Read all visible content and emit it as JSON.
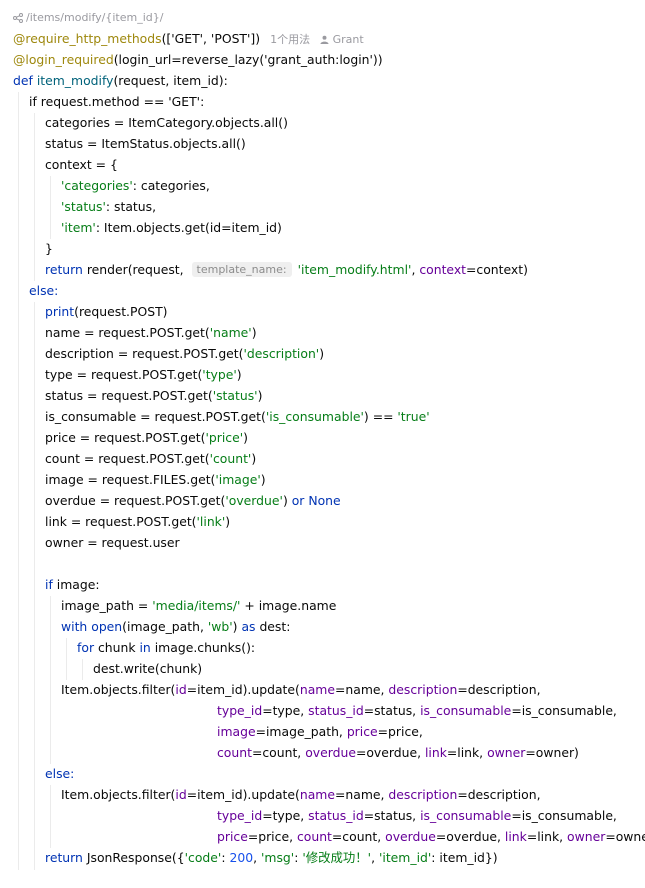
{
  "header": {
    "route": "/items/modify/{item_id}/",
    "usage_count": "1个用法",
    "author": "Grant"
  },
  "code": {
    "l1_dec": "@require_http_methods",
    "l1_args": "(['GET', 'POST'])",
    "l2_dec": "@login_required",
    "l2_args": "(login_url=reverse_lazy('grant_auth:login'))",
    "l3_kw": "def",
    "l3_name": "item_modify",
    "l3_rest": "(request, item_id):",
    "l4": "if request.method == 'GET':",
    "l5": "categories = ItemCategory.objects.all()",
    "l6": "status = ItemStatus.objects.all()",
    "l7": "context = {",
    "l8_str": "'categories'",
    "l8_rest": ": categories,",
    "l9_str": "'status'",
    "l9_rest": ": status,",
    "l10_str": "'item'",
    "l10_rest": ": Item.objects.get(id=item_id)",
    "l11": "}",
    "l12_kw": "return",
    "l12_a": " render(request, ",
    "l12_hint": "template_name:",
    "l12_str": "'item_modify.html'",
    "l12_b": ", ",
    "l12_prm": "context",
    "l12_c": "=context)",
    "l13": "else:",
    "l14_fn": "print",
    "l14_rest": "(request.POST)",
    "l15_a": "name = request.POST.get(",
    "l15_str": "'name'",
    "l16_a": "description = request.POST.get(",
    "l16_str": "'description'",
    "l17_a": "type = request.POST.get(",
    "l17_str": "'type'",
    "l18_a": "status = request.POST.get(",
    "l18_str": "'status'",
    "l19_a": "is_consumable = request.POST.get(",
    "l19_str": "'is_consumable'",
    "l19_b": ") == ",
    "l19_str2": "'true'",
    "l20_a": "price = request.POST.get(",
    "l20_str": "'price'",
    "l21_a": "count = request.POST.get(",
    "l21_str": "'count'",
    "l22_a": "image = request.FILES.get(",
    "l22_str": "'image'",
    "l23_a": "overdue = request.POST.get(",
    "l23_str": "'overdue'",
    "l23_b": ") ",
    "l23_kw": "or None",
    "l24_a": "link = request.POST.get(",
    "l24_str": "'link'",
    "l25": "owner = request.user",
    "l27_kw": "if",
    "l27_rest": " image:",
    "l28_a": "image_path = ",
    "l28_str": "'media/items/'",
    "l28_b": " + image.name",
    "l29_kw": "with",
    "l29_fn": " open",
    "l29_a": "(image_path, ",
    "l29_str": "'wb'",
    "l29_b": ") ",
    "l29_kw2": "as",
    "l29_c": " dest:",
    "l30_kw": "for",
    "l30_a": " chunk ",
    "l30_kw2": "in",
    "l30_b": " image.chunks():",
    "l31": "dest.write(chunk)",
    "l32_a": "Item.objects.filter(",
    "l32_p1": "id",
    "l32_b": "=item_id).update(",
    "l32_p2": "name",
    "l32_c": "=name, ",
    "l32_p3": "description",
    "l32_d": "=description,",
    "l33_p1": "type_id",
    "l33_a": "=type, ",
    "l33_p2": "status_id",
    "l33_b": "=status, ",
    "l33_p3": "is_consumable",
    "l33_c": "=is_consumable,",
    "l34_p1": "image",
    "l34_a": "=image_path, ",
    "l34_p2": "price",
    "l34_b": "=price,",
    "l35_p1": "count",
    "l35_a": "=count, ",
    "l35_p2": "overdue",
    "l35_b": "=overdue, ",
    "l35_p3": "link",
    "l35_c": "=link, ",
    "l35_p4": "owner",
    "l35_d": "=owner)",
    "l36": "else:",
    "l37_a": "Item.objects.filter(",
    "l37_p1": "id",
    "l37_b": "=item_id).update(",
    "l37_p2": "name",
    "l37_c": "=name, ",
    "l37_p3": "description",
    "l37_d": "=description,",
    "l38_p1": "type_id",
    "l38_a": "=type, ",
    "l38_p2": "status_id",
    "l38_b": "=status, ",
    "l38_p3": "is_consumable",
    "l38_c": "=is_consumable,",
    "l39_p1": "price",
    "l39_a": "=price, ",
    "l39_p2": "count",
    "l39_b": "=count, ",
    "l39_p3": "overdue",
    "l39_c": "=overdue, ",
    "l39_p4": "link",
    "l39_d": "=link, ",
    "l39_p5": "owner",
    "l39_e": "=owner)",
    "l40_kw": "return",
    "l40_a": " JsonResponse({",
    "l40_s1": "'code'",
    "l40_b": ": ",
    "l40_n": "200",
    "l40_c": ", ",
    "l40_s2": "'msg'",
    "l40_d": ": ",
    "l40_s3": "'修改成功！'",
    "l40_e": ", ",
    "l40_s4": "'item_id'",
    "l40_f": ": item_id})"
  }
}
